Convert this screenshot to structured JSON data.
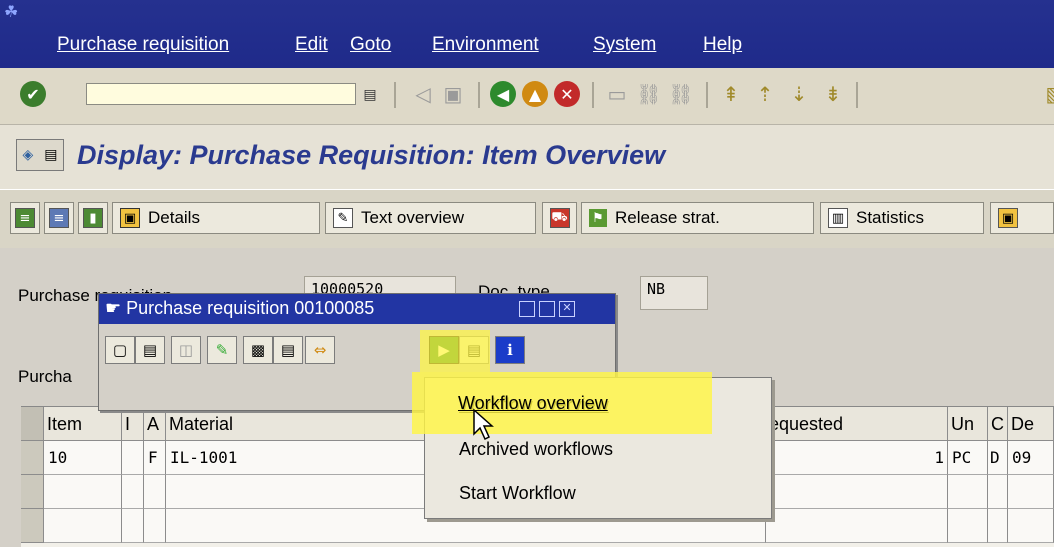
{
  "menubar": {
    "items": [
      "Purchase requisition",
      "Edit",
      "Goto",
      "Environment",
      "System",
      "Help"
    ]
  },
  "toolbar": {
    "command_field_value": ""
  },
  "title": "Display: Purchase Requisition: Item Overview",
  "app_toolbar": {
    "details": "Details",
    "text_overview": "Text overview",
    "release_strat": "Release strat.",
    "statistics": "Statistics"
  },
  "header": {
    "pr_label": "Purcha",
    "pr_label_tail": "se requisition",
    "pr_value": "10000520",
    "doc_type_label": "Doc. type",
    "doc_type_value": "NB",
    "purcha_label": "Purcha"
  },
  "popup": {
    "title": "Purchase requisition 00100085"
  },
  "table": {
    "headers": {
      "item": "Item",
      "i": "I",
      "a": "A",
      "material": "Material",
      "quantity": "equested",
      "unit": "Un",
      "c": "C",
      "de": "De"
    },
    "rows": [
      {
        "item": "10",
        "i": "",
        "a": "F",
        "material": "IL-1001",
        "quantity": "1",
        "unit": "PC",
        "c": "D",
        "de": "09"
      },
      {
        "item": "",
        "i": "",
        "a": "",
        "material": "",
        "quantity": "",
        "unit": "",
        "c": "",
        "de": ""
      },
      {
        "item": "",
        "i": "",
        "a": "",
        "material": "",
        "quantity": "",
        "unit": "",
        "c": "",
        "de": ""
      }
    ]
  },
  "context_menu": {
    "items": [
      "Workflow overview",
      "Archived workflows",
      "Start Workflow"
    ]
  },
  "colors": {
    "menubar": "#25318f",
    "title_text": "#2a3a8f",
    "highlight": "#fff546"
  }
}
